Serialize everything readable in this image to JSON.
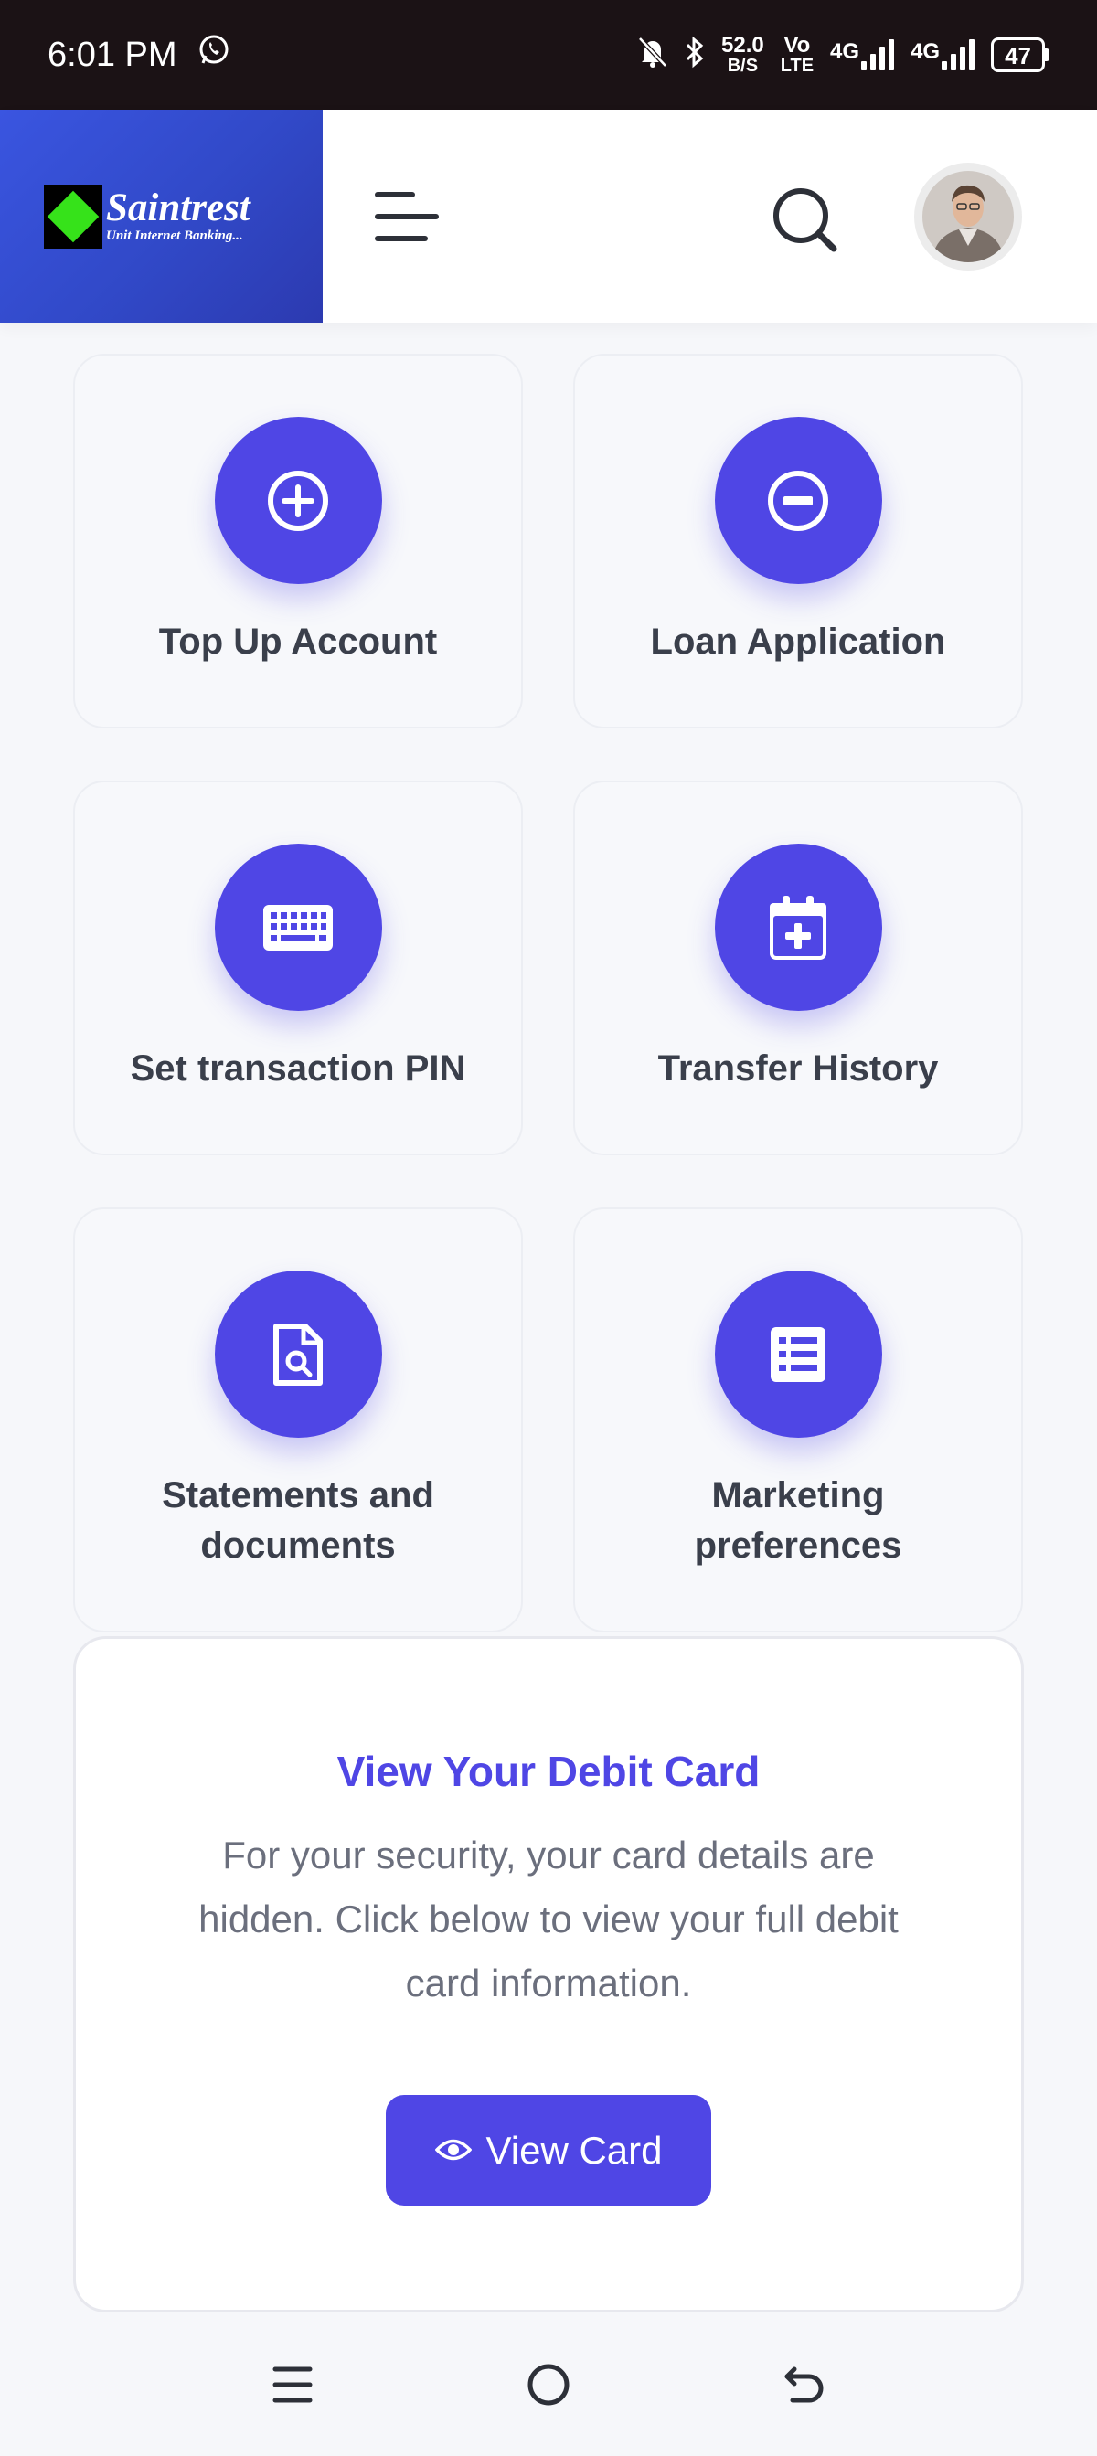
{
  "status_bar": {
    "time": "6:01 PM",
    "network_speed_value": "52.0",
    "network_speed_unit": "B/S",
    "volte_top": "Vo",
    "volte_bottom": "LTE",
    "sim1_label": "4G",
    "sim2_label": "4G",
    "battery": "47"
  },
  "header": {
    "brand_name": "Saintrest",
    "brand_tagline": "Unit Internet Banking..."
  },
  "tiles": [
    {
      "label": "Top Up Account",
      "icon": "plus-circle-icon"
    },
    {
      "label": "Loan Application",
      "icon": "minus-circle-icon"
    },
    {
      "label": "Set transaction PIN",
      "icon": "keyboard-icon"
    },
    {
      "label": "Transfer History",
      "icon": "calendar-plus-icon"
    },
    {
      "label": "Statements and documents",
      "icon": "document-search-icon"
    },
    {
      "label": "Marketing preferences",
      "icon": "list-icon"
    }
  ],
  "debit_card": {
    "title": "View Your Debit Card",
    "description": "For your security, your card details are hidden. Click below to view your full debit card information.",
    "button_label": "View Card"
  },
  "colors": {
    "accent": "#4f46e5",
    "brand_gradient_start": "#3a55e0",
    "brand_logo_green": "#36e21a",
    "status_bar_bg": "#1b1215"
  }
}
